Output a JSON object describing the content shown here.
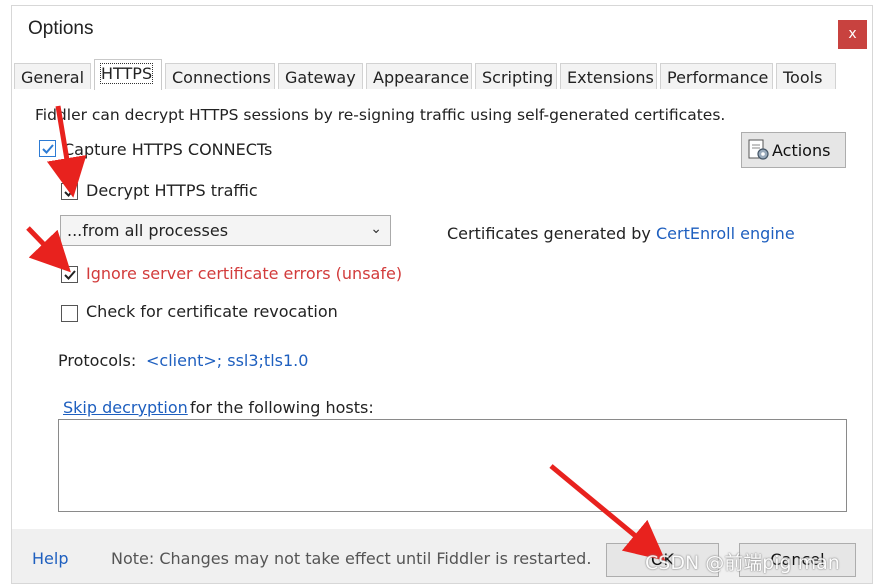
{
  "window": {
    "title": "Options",
    "close_glyph": "x"
  },
  "tabs": [
    "General",
    "HTTPS",
    "Connections",
    "Gateway",
    "Appearance",
    "Scripting",
    "Extensions",
    "Performance",
    "Tools"
  ],
  "https": {
    "description": "Fiddler can decrypt HTTPS sessions by re-signing traffic using self-generated certificates.",
    "capture_label": "Capture HTTPS CONNECTs",
    "capture_checked": true,
    "actions_label": "Actions",
    "decrypt_label": "Decrypt HTTPS traffic",
    "decrypt_checked": true,
    "process_filter": "...from all processes",
    "cert_prefix": "Certificates generated by",
    "cert_engine": "CertEnroll engine",
    "ignore_errors_label": "Ignore server certificate errors (unsafe)",
    "ignore_errors_checked": true,
    "revocation_label": "Check for certificate revocation",
    "revocation_checked": false,
    "protocols_label": "Protocols:",
    "protocols_value": "<client>; ssl3;tls1.0",
    "skip_link": "Skip decryption",
    "skip_suffix": "for the following hosts:",
    "hosts_value": ""
  },
  "footer": {
    "help": "Help",
    "note": "Note: Changes may not take effect until Fiddler is restarted.",
    "ok": "OK",
    "cancel": "Cancel"
  },
  "watermark": "CSDN @前端pig man",
  "colors": {
    "accent": "#1e5fbf",
    "warning": "#d23b3b",
    "close": "#c8423f",
    "annotation_arrow": "#e8221e"
  }
}
